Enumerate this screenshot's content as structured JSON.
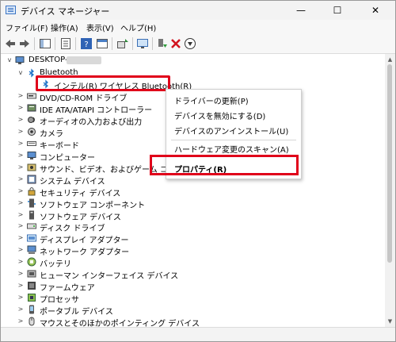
{
  "window": {
    "title": "デバイス マネージャー",
    "controls": {
      "minimize": "—",
      "maximize": "☐",
      "close": "✕"
    }
  },
  "menubar": {
    "file": "ファイル(F)",
    "action": "操作(A)",
    "view": "表示(V)",
    "help": "ヘルプ(H)"
  },
  "toolbar": {
    "icons": [
      "back-arrow-icon",
      "forward-arrow-icon",
      "show-hide-console-tree-icon",
      "properties-icon",
      "help-icon",
      "action-pane-icon",
      "update-driver-icon",
      "scan-hardware-icon",
      "enable-device-icon",
      "uninstall-device-icon",
      "disable-device-icon"
    ]
  },
  "tree": {
    "root": "DESKTOP-",
    "bluetooth": "Bluetooth",
    "bluetooth_device": "インテル(R) ワイヤレス Bluetooth(R)",
    "categories": [
      {
        "label": "DVD/CD-ROM ドライブ",
        "icon": "dvd-drive-icon"
      },
      {
        "label": "IDE ATA/ATAPI コントローラー",
        "icon": "ide-controller-icon"
      },
      {
        "label": "オーディオの入力および出力",
        "icon": "audio-io-icon"
      },
      {
        "label": "カメラ",
        "icon": "camera-icon"
      },
      {
        "label": "キーボード",
        "icon": "keyboard-icon"
      },
      {
        "label": "コンピューター",
        "icon": "computer-icon"
      },
      {
        "label": "サウンド、ビデオ、およびゲーム コント",
        "icon": "sound-video-icon"
      },
      {
        "label": "システム デバイス",
        "icon": "system-devices-icon"
      },
      {
        "label": "セキュリティ デバイス",
        "icon": "security-devices-icon"
      },
      {
        "label": "ソフトウェア コンポーネント",
        "icon": "software-components-icon"
      },
      {
        "label": "ソフトウェア デバイス",
        "icon": "software-devices-icon"
      },
      {
        "label": "ディスク ドライブ",
        "icon": "disk-drive-icon"
      },
      {
        "label": "ディスプレイ アダプター",
        "icon": "display-adapter-icon"
      },
      {
        "label": "ネットワーク アダプター",
        "icon": "network-adapter-icon"
      },
      {
        "label": "バッテリ",
        "icon": "battery-icon"
      },
      {
        "label": "ヒューマン インターフェイス デバイス",
        "icon": "hid-icon"
      },
      {
        "label": "ファームウェア",
        "icon": "firmware-icon"
      },
      {
        "label": "プロセッサ",
        "icon": "processor-icon"
      },
      {
        "label": "ポータブル デバイス",
        "icon": "portable-devices-icon"
      },
      {
        "label": "マウスとそのほかのポインティング デバイス",
        "icon": "mouse-icon"
      }
    ]
  },
  "context_menu": {
    "update_driver": "ドライバーの更新(P)",
    "disable_device": "デバイスを無効にする(D)",
    "uninstall_device": "デバイスのアンインストール(U)",
    "scan_hardware": "ハードウェア変更のスキャン(A)",
    "properties": "プロパティ(R)"
  },
  "colors": {
    "highlight": "#e0001a",
    "bluetooth": "#1f73c8"
  }
}
